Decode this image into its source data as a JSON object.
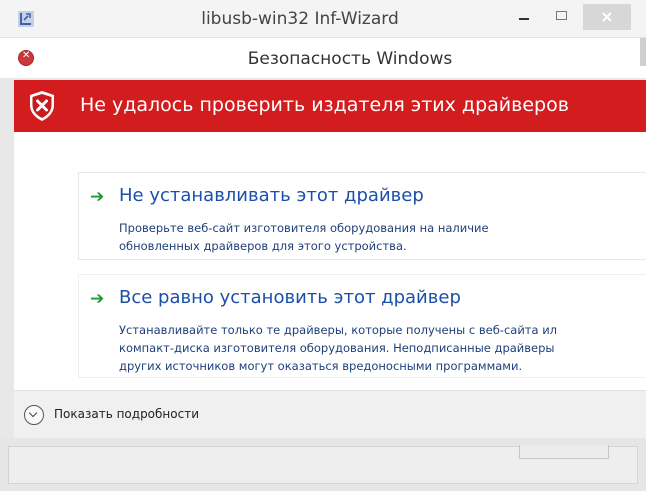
{
  "outer_window": {
    "title": "libusb-win32 Inf-Wizard",
    "app_icon": "usb-app-icon",
    "controls": {
      "minimize_icon": "minimize-icon",
      "maximize_icon": "maximize-icon",
      "close_glyph": "×"
    }
  },
  "dialog": {
    "title": "Безопасность Windows",
    "title_icon": "security-error-icon",
    "banner": {
      "icon": "shield-x-icon",
      "text": "Не удалось проверить издателя этих драйверов",
      "color": "#d21c1e"
    },
    "options": [
      {
        "icon": "green-arrow-icon",
        "arrow": "➔",
        "title": "Не устанавливать этот драйвер",
        "description": "Проверьте веб-сайт изготовителя оборудования на наличие\nобновленных драйверов для этого устройства."
      },
      {
        "icon": "green-arrow-icon",
        "arrow": "➔",
        "title": "Все равно установить этот драйвер",
        "description": "Устанавливайте только те драйверы, которые получены с веб-сайта ил\nкомпакт-диска изготовителя оборудования. Неподписанные драйверы\nдругих источников могут оказаться вредоносными программами."
      }
    ],
    "details_toggle": {
      "icon": "chevron-down-circle-icon",
      "label": "Показать подробности"
    }
  },
  "colors": {
    "accent_red": "#d21c1e",
    "option_title": "#1b4fa8",
    "option_desc": "#1e3f7a",
    "arrow_green": "#1a9a2f"
  }
}
